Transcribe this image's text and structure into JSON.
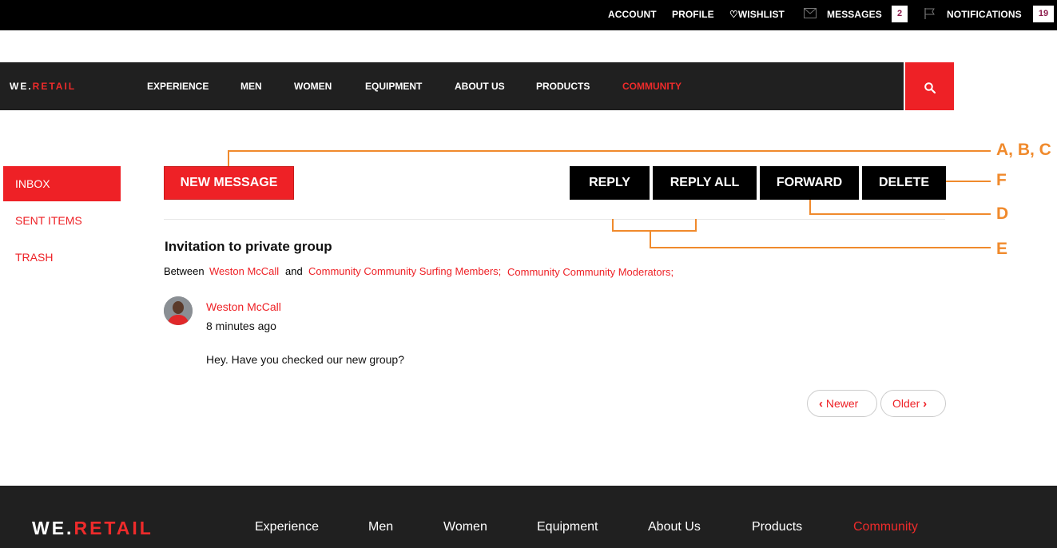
{
  "topbar": {
    "account": "ACCOUNT",
    "profile": "PROFILE",
    "wishlist": "WISHLIST",
    "messages": "MESSAGES",
    "messages_count": "2",
    "notifications": "NOTIFICATIONS",
    "notifications_count": "19"
  },
  "logo": {
    "we": "WE.",
    "retail": "RETAIL"
  },
  "nav": {
    "items": [
      "EXPERIENCE",
      "MEN",
      "WOMEN",
      "EQUIPMENT",
      "ABOUT US",
      "PRODUCTS",
      "COMMUNITY"
    ],
    "active": "COMMUNITY"
  },
  "sidebar": {
    "items": [
      "INBOX",
      "SENT ITEMS",
      "TRASH"
    ],
    "active": "INBOX"
  },
  "actions": {
    "new_message": "NEW MESSAGE",
    "reply": "REPLY",
    "reply_all": "REPLY ALL",
    "forward": "FORWARD",
    "delete": "DELETE"
  },
  "message": {
    "subject": "Invitation to private group",
    "between_label": "Between",
    "sender": "Weston McCall",
    "and_label": "and",
    "recipients": [
      "Community Community Surfing Members;",
      "Community Community Moderators;"
    ],
    "author": "Weston McCall",
    "time": "8 minutes ago",
    "body": "Hey. Have you checked our new group?"
  },
  "pagination": {
    "newer": "Newer",
    "older": "Older"
  },
  "annotations": {
    "abc": "A, B, C",
    "f": "F",
    "d": "D",
    "e": "E"
  },
  "footer": {
    "logo_we": "WE.",
    "logo_retail": "RETAIL",
    "items": [
      "Experience",
      "Men",
      "Women",
      "Equipment",
      "About Us",
      "Products",
      "Community"
    ],
    "active": "Community"
  },
  "colors": {
    "accent": "#ee2126",
    "annotation": "#f08a2c",
    "nav_bg": "#202020",
    "topbar_bg": "#000000"
  }
}
